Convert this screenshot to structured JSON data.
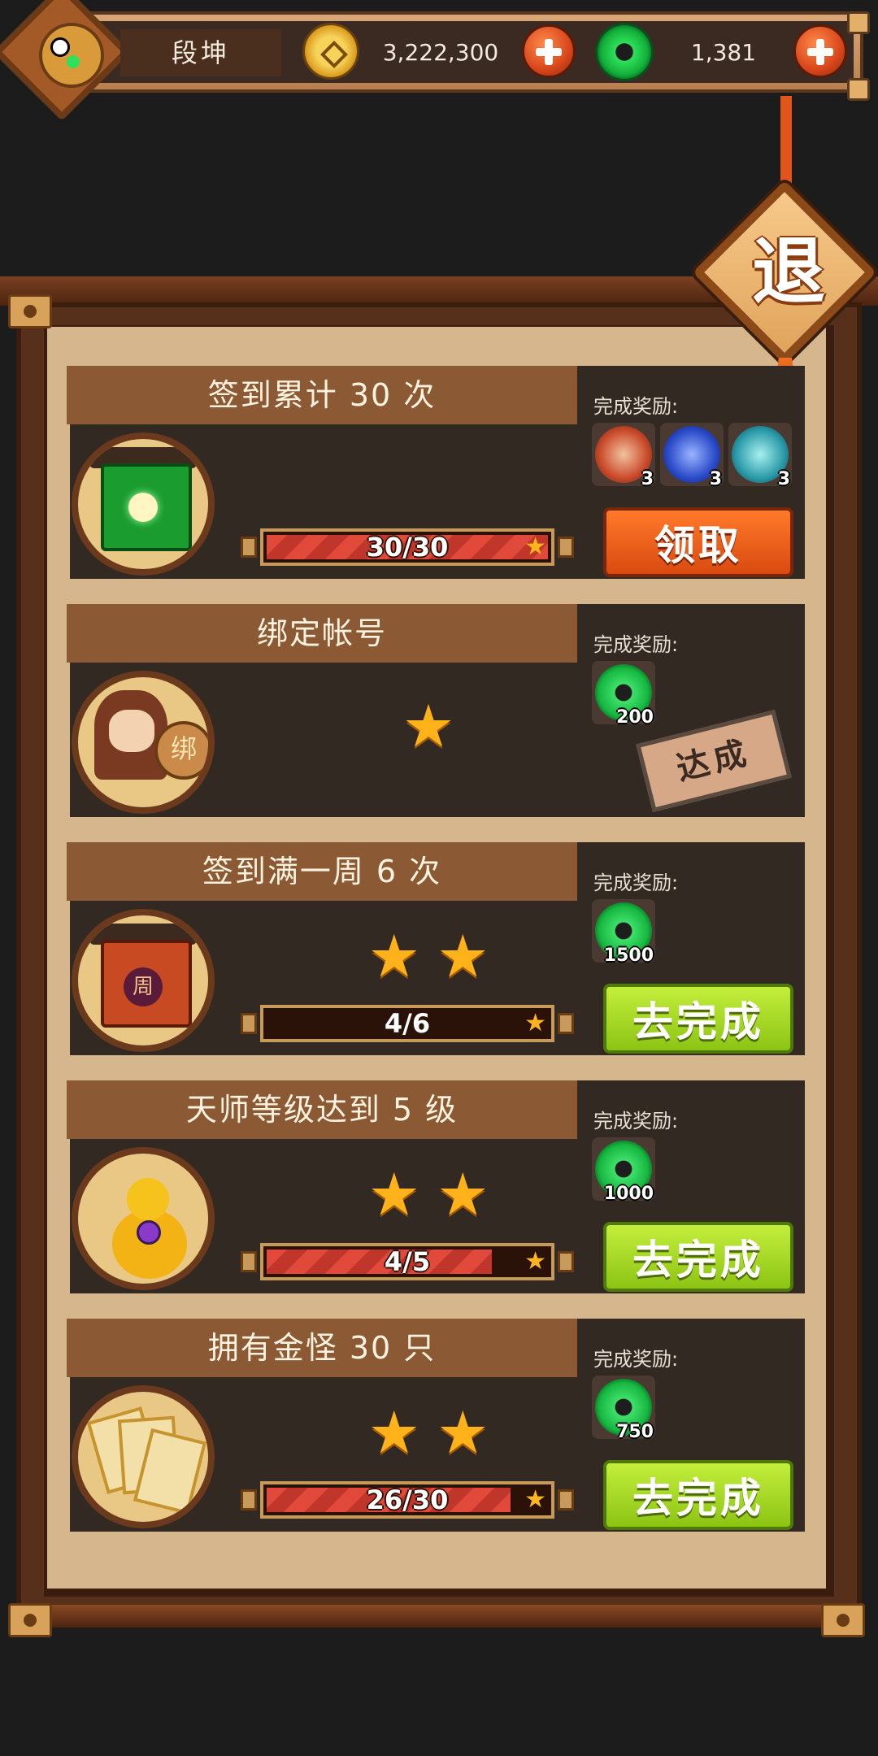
{
  "player": {
    "name": "段坤",
    "coins": "3,222,300",
    "jade": "1,381"
  },
  "exit_label": "退",
  "reward_label": "完成奖励:",
  "tasks": [
    {
      "title": "签到累计 30 次",
      "progress_text": "30/30",
      "progress": 1.0,
      "stars": 0,
      "rewards": [
        {
          "icon": "red-gem-orb",
          "count": "3"
        },
        {
          "icon": "blue-crystal-orb",
          "count": "3"
        },
        {
          "icon": "teal-orb",
          "count": "3"
        }
      ],
      "action": "领取",
      "state": "claimable",
      "icon": "jade-temple-icon"
    },
    {
      "title": "绑定帐号",
      "progress_text": "",
      "stars": 1,
      "rewards": [
        {
          "icon": "jade-icon",
          "count": "200"
        }
      ],
      "action": "达成",
      "state": "completed",
      "icon": "boy-bind-icon",
      "icon_text": "绑"
    },
    {
      "title": "签到满一周 6 次",
      "progress_text": "4/6",
      "progress": 0.0,
      "stars": 2,
      "rewards": [
        {
          "icon": "jade-icon",
          "count": "1500"
        }
      ],
      "action": "去完成",
      "state": "todo",
      "icon": "red-temple-icon",
      "icon_text": "周"
    },
    {
      "title": "天师等级达到 5 级",
      "progress_text": "4/5",
      "progress": 0.8,
      "stars": 2,
      "rewards": [
        {
          "icon": "jade-icon",
          "count": "1000"
        }
      ],
      "action": "去完成",
      "state": "todo",
      "icon": "gourd-icon"
    },
    {
      "title": "拥有金怪 30 只",
      "progress_text": "26/30",
      "progress": 0.8667,
      "stars": 2,
      "rewards": [
        {
          "icon": "jade-icon",
          "count": "750"
        }
      ],
      "action": "去完成",
      "state": "todo",
      "icon": "cards-icon"
    }
  ],
  "colors": {
    "claim": "#e05418",
    "go": "#a6d61e",
    "progress": "#e14a3a",
    "star": "#ffb21a"
  }
}
